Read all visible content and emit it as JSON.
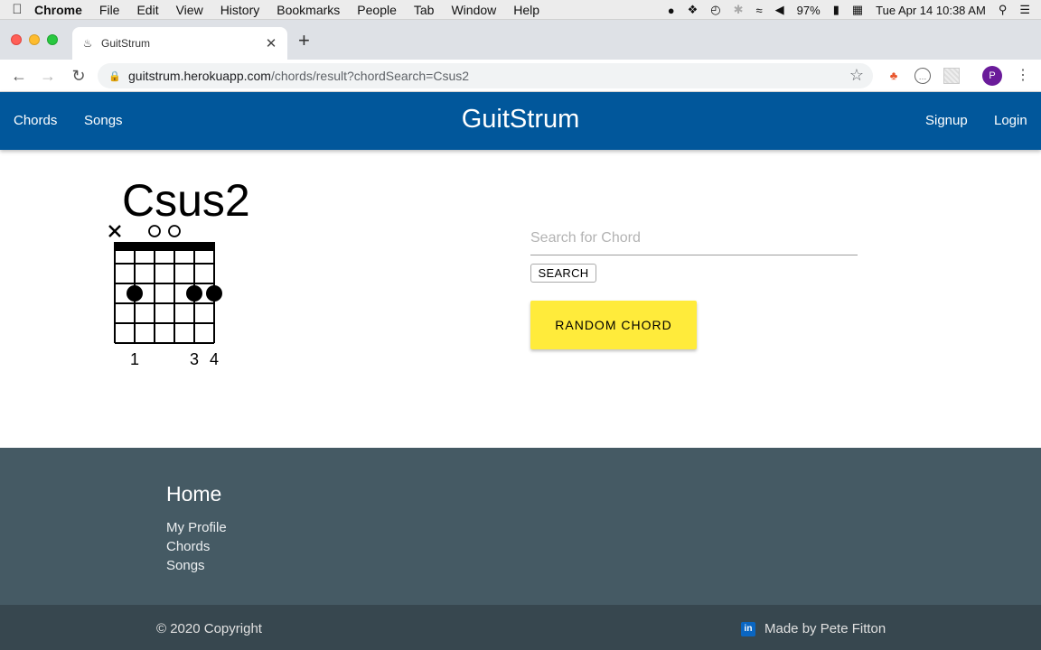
{
  "menubar": {
    "items": [
      "Chrome",
      "File",
      "Edit",
      "View",
      "History",
      "Bookmarks",
      "People",
      "Tab",
      "Window",
      "Help"
    ],
    "battery": "97%",
    "clock": "Tue Apr 14  10:38 AM"
  },
  "browser": {
    "tab_title": "GuitStrum",
    "url_host": "guitstrum.herokuapp.com",
    "url_path": "/chords/result?chordSearch=Csus2",
    "profile_initial": "P"
  },
  "nav": {
    "chords": "Chords",
    "songs": "Songs",
    "brand": "GuitStrum",
    "signup": "Signup",
    "login": "Login",
    "color": "#01579b"
  },
  "chord": {
    "name": "Csus2",
    "string_markers": [
      "x",
      "",
      "o",
      "o",
      "",
      ""
    ],
    "dots": [
      {
        "string": 2,
        "fret": 3
      },
      {
        "string": 5,
        "fret": 3
      },
      {
        "string": 6,
        "fret": 3
      }
    ],
    "fingers": [
      "",
      "1",
      "",
      "",
      "3",
      "4"
    ],
    "frets_shown": 5
  },
  "search": {
    "placeholder": "Search for Chord",
    "value": "",
    "button": "SEARCH",
    "random_button": "RANDOM CHORD",
    "random_color": "#ffeb3b"
  },
  "footer": {
    "heading": "Home",
    "links": [
      "My Profile",
      "Chords",
      "Songs"
    ],
    "copyright": "© 2020 Copyright",
    "made_by": "Made by Pete Fitton",
    "linkedin_icon_text": "in",
    "bg": "#455a64",
    "bottom_bg": "#37474f"
  }
}
